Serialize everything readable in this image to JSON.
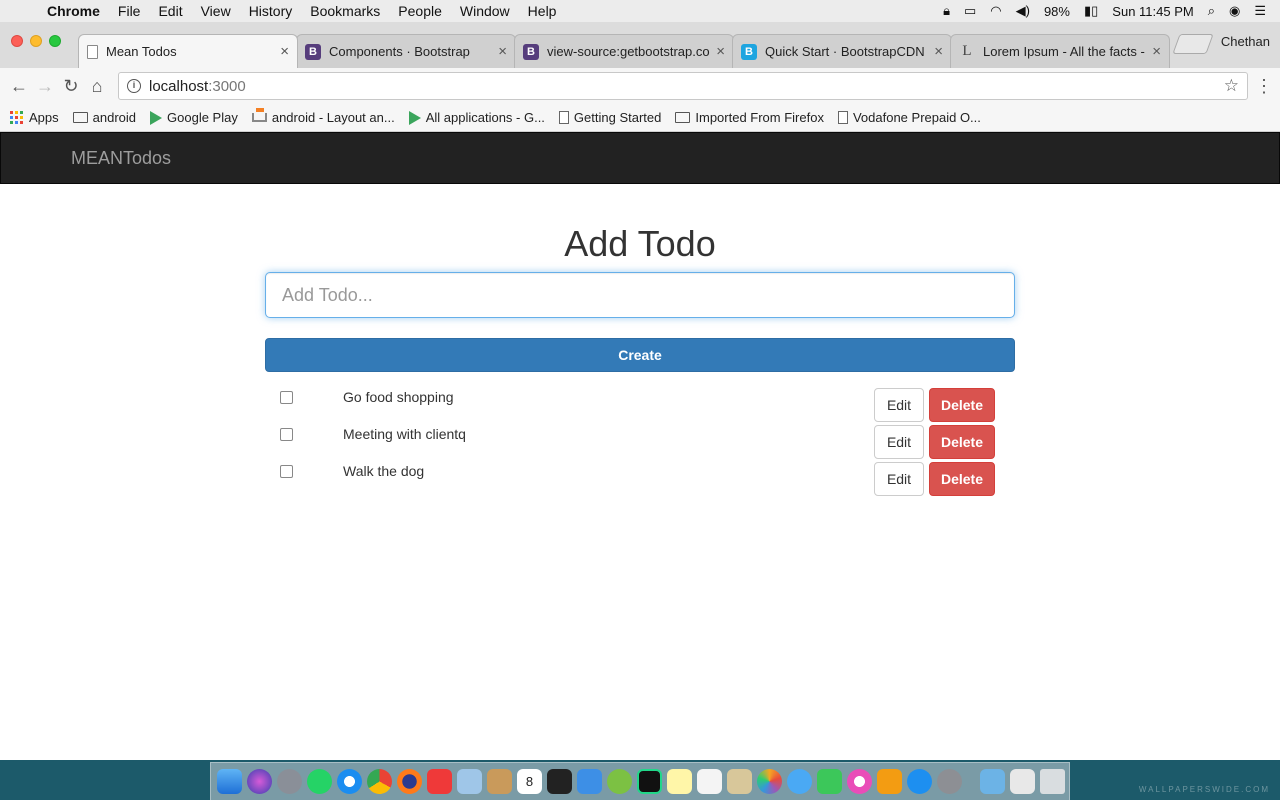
{
  "menubar": {
    "app_name": "Chrome",
    "items": [
      "File",
      "Edit",
      "View",
      "History",
      "Bookmarks",
      "People",
      "Window",
      "Help"
    ],
    "battery": "98%",
    "clock": "Sun 11:45 PM"
  },
  "browser": {
    "tabs": [
      {
        "title": "Mean Todos",
        "icon": "document-icon",
        "active": true
      },
      {
        "title": "Components · Bootstrap",
        "icon": "bootstrap-icon"
      },
      {
        "title": "view-source:getbootstrap.co",
        "icon": "bootstrap-icon"
      },
      {
        "title": "Quick Start · BootstrapCDN b",
        "icon": "bootstrapcdn-icon"
      },
      {
        "title": "Lorem Ipsum - All the facts -",
        "icon": "lorem-icon"
      }
    ],
    "profile_name": "Chethan",
    "url_host": "localhost",
    "url_port": ":3000",
    "bookmarks": [
      {
        "label": "Apps",
        "icon": "apps-grid-icon"
      },
      {
        "label": "android",
        "icon": "folder-icon"
      },
      {
        "label": "Google Play",
        "icon": "google-play-icon"
      },
      {
        "label": "android - Layout an...",
        "icon": "stackoverflow-icon"
      },
      {
        "label": "All applications - G...",
        "icon": "google-play-icon"
      },
      {
        "label": "Getting Started",
        "icon": "page-icon"
      },
      {
        "label": "Imported From Firefox",
        "icon": "folder-icon"
      },
      {
        "label": "Vodafone Prepaid O...",
        "icon": "page-icon"
      }
    ]
  },
  "app": {
    "brand": "MEANTodos",
    "heading": "Add Todo",
    "input_placeholder": "Add Todo...",
    "create_label": "Create",
    "edit_label": "Edit",
    "delete_label": "Delete",
    "todos": [
      {
        "text": "Go food shopping",
        "done": false
      },
      {
        "text": "Meeting with clientq",
        "done": false
      },
      {
        "text": "Walk the dog",
        "done": false
      }
    ]
  },
  "dock": {
    "apps": [
      "finder",
      "siri",
      "launchpad",
      "whatsapp",
      "safari",
      "chrome",
      "firefox",
      "vivaldi",
      "preview",
      "notes-folder",
      "calendar",
      "terminal",
      "xcode",
      "android-studio",
      "webstorm",
      "notes",
      "reminders",
      "contacts",
      "photos",
      "messages",
      "facetime",
      "itunes",
      "ibooks",
      "app-store",
      "system-preferences",
      "downloads",
      "documents",
      "trash"
    ],
    "calendar_day": "8"
  },
  "wallpaper_credit": "WALLPAPERSWIDE.COM",
  "colors": {
    "primary": "#337ab7",
    "danger": "#d9534f",
    "navbar": "#222222"
  }
}
